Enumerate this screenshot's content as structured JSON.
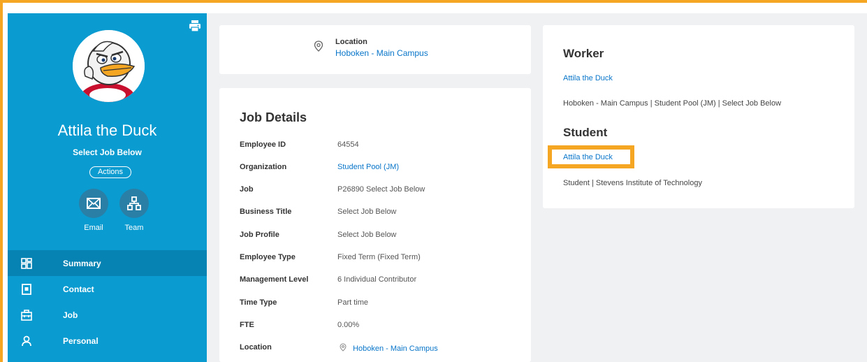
{
  "sidebar": {
    "worker_name": "Attila the Duck",
    "job_subtitle": "Select Job Below",
    "actions_label": "Actions",
    "quick_actions": [
      {
        "label": "Email",
        "icon": "envelope-icon"
      },
      {
        "label": "Team",
        "icon": "org-chart-icon"
      }
    ],
    "nav": [
      {
        "label": "Summary",
        "icon": "grid-icon",
        "active": true
      },
      {
        "label": "Contact",
        "icon": "contact-card-icon",
        "active": false
      },
      {
        "label": "Job",
        "icon": "briefcase-icon",
        "active": false
      },
      {
        "label": "Personal",
        "icon": "person-icon",
        "active": false
      }
    ],
    "print_icon": "printer-icon"
  },
  "location_card": {
    "title": "Location",
    "value": "Hoboken - Main Campus"
  },
  "job_details": {
    "title": "Job Details",
    "rows": [
      {
        "label": "Employee ID",
        "value": "64554",
        "link": false
      },
      {
        "label": "Organization",
        "value": "Student Pool (JM)",
        "link": true
      },
      {
        "label": "Job",
        "value": "P26890 Select Job Below",
        "link": false
      },
      {
        "label": "Business Title",
        "value": "Select Job Below",
        "link": false
      },
      {
        "label": "Job Profile",
        "value": "Select Job Below",
        "link": false
      },
      {
        "label": "Employee Type",
        "value": "Fixed Term (Fixed Term)",
        "link": false
      },
      {
        "label": "Management Level",
        "value": "6 Individual Contributor",
        "link": false
      },
      {
        "label": "Time Type",
        "value": "Part time",
        "link": false
      },
      {
        "label": "FTE",
        "value": "0.00%",
        "link": false
      },
      {
        "label": "Location",
        "value": "Hoboken - Main Campus",
        "link": true
      }
    ]
  },
  "roles_card": {
    "worker_heading": "Worker",
    "worker_link": "Attila the Duck",
    "worker_info": "Hoboken - Main Campus | Student Pool (JM) | Select Job Below",
    "student_heading": "Student",
    "student_link": "Attila the Duck",
    "student_info": "Student | Stevens Institute of Technology"
  },
  "colors": {
    "sidebar": "#0a9bd0",
    "sidebar_active": "#0783b3",
    "link": "#0875c9",
    "highlight": "#f5a623",
    "page_bg": "#eff1f3"
  }
}
